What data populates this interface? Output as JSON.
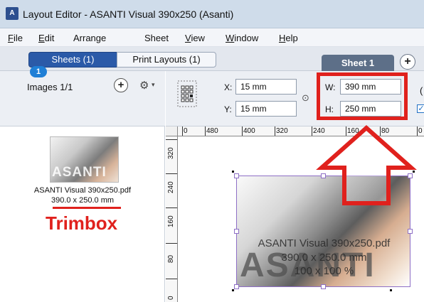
{
  "window": {
    "app_icon": "A",
    "title": "Layout Editor - ASANTI Visual 390x250 (Asanti)"
  },
  "menu": [
    {
      "mnemonic": "F",
      "rest": "ile"
    },
    {
      "mnemonic": "E",
      "rest": "dit"
    },
    {
      "mnemonic": "",
      "rest": "Arrange"
    },
    {
      "mnemonic": "",
      "rest": "Sheet"
    },
    {
      "mnemonic": "V",
      "rest": "iew"
    },
    {
      "mnemonic": "W",
      "rest": "indow"
    },
    {
      "mnemonic": "H",
      "rest": "elp"
    }
  ],
  "tabs": {
    "sheets": "Sheets (1)",
    "print_layouts": "Print Layouts (1)",
    "sheet1": "Sheet 1",
    "add_glyph": "+"
  },
  "left_panel": {
    "images_label": "Images 1/1",
    "add_glyph": "+",
    "gear_glyph": "⚙",
    "caret_glyph": "▾",
    "badge": "1",
    "thumb_name": "ASANTI Visual 390x250.pdf",
    "thumb_size": "390.0 x 250.0 mm",
    "thumb_word": "ASANTI",
    "annotation": "Trimbox"
  },
  "properties": {
    "x_label": "X:",
    "x_value": "15 mm",
    "y_label": "Y:",
    "y_value": "15 mm",
    "w_label": "W:",
    "w_value": "390 mm",
    "h_label": "H:",
    "h_value": "250 mm",
    "link_glyph": "⊙",
    "partial_paren": "(",
    "partial_check": "✓"
  },
  "rulers": {
    "top": [
      "0",
      "480",
      "400",
      "320",
      "240",
      "160",
      "80",
      "0"
    ],
    "left": [
      "320",
      "240",
      "160",
      "80",
      "0"
    ]
  },
  "placed_image": {
    "word": "ASANTI",
    "name": "ASANTI Visual 390x250.pdf",
    "size": "390.0 x 250.0 mm",
    "scale": "100 x 100 %"
  },
  "colors": {
    "annotation_red": "#e0211d",
    "tab_blue": "#2b5aa8",
    "selection_purple": "#8e6fc6"
  }
}
